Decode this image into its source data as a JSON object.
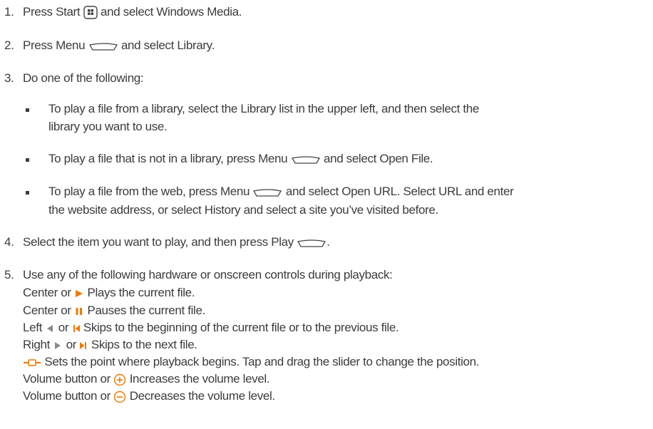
{
  "steps": [
    {
      "num": "1.",
      "pre": "Press Start",
      "post": "and select Windows Media."
    },
    {
      "num": "2.",
      "pre": "Press Menu",
      "post": "and select Library."
    },
    {
      "num": "3.",
      "text": "Do one of the following:"
    },
    {
      "num": "4.",
      "pre": "Select the item you want to play, and then press Play",
      "post": "."
    },
    {
      "num": "5.",
      "text": "Use any of the following hardware or onscreen controls during playback:"
    }
  ],
  "sub_items": [
    {
      "line1": "To play a file from a library, select the Library list in the upper left, and then select the",
      "line2": "library you want to use."
    },
    {
      "pre": "To play a file that is not in a library, press Menu",
      "post": "and select Open File."
    },
    {
      "pre": "To play a file from the web, press Menu",
      "post": "and select Open URL. Select URL and enter",
      "line2": "the website address, or select History and select a site you’ve visited before."
    }
  ],
  "controls": [
    {
      "pre": "Center or",
      "post": "Plays the current file.",
      "icon": "play-icon"
    },
    {
      "pre": "Center or",
      "post": "Pauses the current file.",
      "icon": "pause-icon"
    },
    {
      "pre": "Left",
      "mid": "or",
      "post": "Skips to the beginning of the current file or to the previous file.",
      "icon": "previous-icon"
    },
    {
      "pre": "Right",
      "mid": "or",
      "post": "Skips to the next file.",
      "icon": "next-icon"
    },
    {
      "post": "Sets the point where playback begins. Tap and drag the slider to change the position.",
      "icon": "seek-slider-icon"
    },
    {
      "pre": "Volume button or",
      "post": "Increases the volume level.",
      "icon": "volume-up-icon"
    },
    {
      "pre": "Volume button or",
      "post": "Decreases the volume level.",
      "icon": "volume-down-icon"
    }
  ],
  "colors": {
    "text": "#3c3c3c",
    "icon_accent": "#f07800",
    "icon_gray": "#8a8a8a"
  }
}
